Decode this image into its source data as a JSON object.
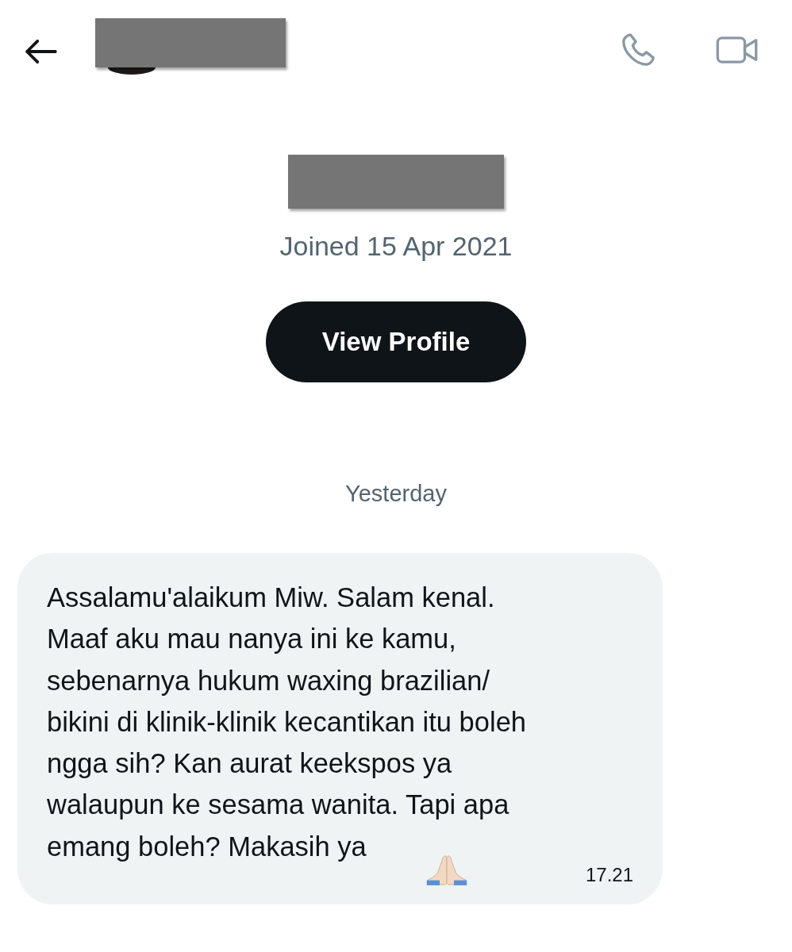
{
  "profile": {
    "joined": "Joined 15 Apr 2021",
    "button": "View Profile"
  },
  "date_divider": "Yesterday",
  "messages": [
    {
      "lines": [
        "Assalamu'alaikum Miw. Salam kenal.",
        "Maaf aku mau nanya ini ke kamu,",
        "sebenarnya hukum waxing brazilian/",
        "bikini di klinik-klinik kecantikan itu boleh",
        "ngga sih? Kan aurat keekspos ya",
        "walaupun ke sesama wanita. Tapi apa",
        "emang boleh? Makasih ya"
      ],
      "time": "17.21"
    }
  ]
}
